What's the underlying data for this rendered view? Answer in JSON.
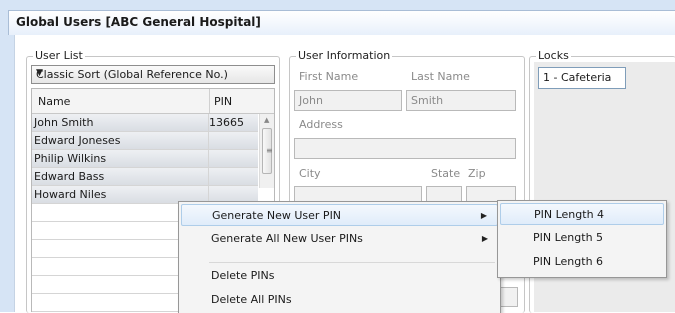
{
  "window": {
    "title": "Global Users [ABC General Hospital]"
  },
  "user_list": {
    "legend": "User List",
    "sort_selected": "Classic Sort (Global Reference No.)",
    "columns": {
      "name": "Name",
      "pin": "PIN"
    },
    "rows": [
      {
        "name": "John Smith",
        "pin": "13665"
      },
      {
        "name": "Edward Joneses",
        "pin": ""
      },
      {
        "name": "Philip Wilkins",
        "pin": ""
      },
      {
        "name": "Edward Bass",
        "pin": ""
      },
      {
        "name": "Howard Niles",
        "pin": ""
      }
    ]
  },
  "user_info": {
    "legend": "User Information",
    "first_name_label": "First Name",
    "last_name_label": "Last Name",
    "first_name_value": "John",
    "last_name_value": "Smith",
    "address_label": "Address",
    "city_label": "City",
    "state_label": "State",
    "zip_label": "Zip"
  },
  "locks": {
    "legend": "Locks",
    "items": [
      "1 - Cafeteria"
    ]
  },
  "context_menu": {
    "items": [
      {
        "label": "Generate New User PIN",
        "has_submenu": true,
        "highlighted": true
      },
      {
        "label": "Generate All New User PINs",
        "has_submenu": true
      },
      {
        "label": "Delete PINs",
        "has_submenu": false
      },
      {
        "label": "Delete All PINs",
        "has_submenu": false
      }
    ],
    "submenu": [
      {
        "label": "PIN Length 4",
        "highlighted": true
      },
      {
        "label": "PIN Length 5"
      },
      {
        "label": "PIN Length 6"
      }
    ]
  },
  "icons": {
    "dropdown": "chevron-down-icon",
    "submenu_arrow": "triangle-right-icon"
  },
  "colors": {
    "frame": "#d6e4f5",
    "row_fill": "#d9dde3",
    "menu_highlight": "#e0ecfa",
    "menu_highlight_border": "#aecde9"
  }
}
